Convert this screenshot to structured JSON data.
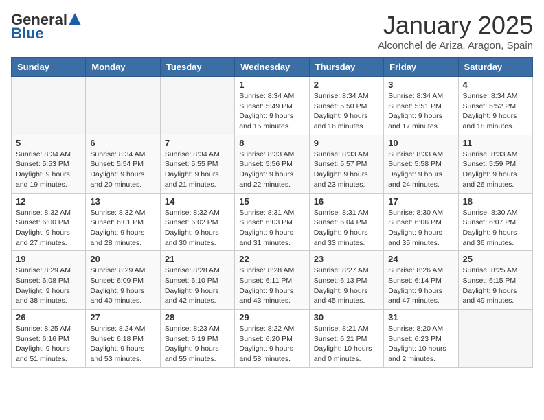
{
  "header": {
    "logo_general": "General",
    "logo_blue": "Blue",
    "month_title": "January 2025",
    "subtitle": "Alconchel de Ariza, Aragon, Spain"
  },
  "days_of_week": [
    "Sunday",
    "Monday",
    "Tuesday",
    "Wednesday",
    "Thursday",
    "Friday",
    "Saturday"
  ],
  "weeks": [
    [
      {
        "day": "",
        "info": ""
      },
      {
        "day": "",
        "info": ""
      },
      {
        "day": "",
        "info": ""
      },
      {
        "day": "1",
        "info": "Sunrise: 8:34 AM\nSunset: 5:49 PM\nDaylight: 9 hours\nand 15 minutes."
      },
      {
        "day": "2",
        "info": "Sunrise: 8:34 AM\nSunset: 5:50 PM\nDaylight: 9 hours\nand 16 minutes."
      },
      {
        "day": "3",
        "info": "Sunrise: 8:34 AM\nSunset: 5:51 PM\nDaylight: 9 hours\nand 17 minutes."
      },
      {
        "day": "4",
        "info": "Sunrise: 8:34 AM\nSunset: 5:52 PM\nDaylight: 9 hours\nand 18 minutes."
      }
    ],
    [
      {
        "day": "5",
        "info": "Sunrise: 8:34 AM\nSunset: 5:53 PM\nDaylight: 9 hours\nand 19 minutes."
      },
      {
        "day": "6",
        "info": "Sunrise: 8:34 AM\nSunset: 5:54 PM\nDaylight: 9 hours\nand 20 minutes."
      },
      {
        "day": "7",
        "info": "Sunrise: 8:34 AM\nSunset: 5:55 PM\nDaylight: 9 hours\nand 21 minutes."
      },
      {
        "day": "8",
        "info": "Sunrise: 8:33 AM\nSunset: 5:56 PM\nDaylight: 9 hours\nand 22 minutes."
      },
      {
        "day": "9",
        "info": "Sunrise: 8:33 AM\nSunset: 5:57 PM\nDaylight: 9 hours\nand 23 minutes."
      },
      {
        "day": "10",
        "info": "Sunrise: 8:33 AM\nSunset: 5:58 PM\nDaylight: 9 hours\nand 24 minutes."
      },
      {
        "day": "11",
        "info": "Sunrise: 8:33 AM\nSunset: 5:59 PM\nDaylight: 9 hours\nand 26 minutes."
      }
    ],
    [
      {
        "day": "12",
        "info": "Sunrise: 8:32 AM\nSunset: 6:00 PM\nDaylight: 9 hours\nand 27 minutes."
      },
      {
        "day": "13",
        "info": "Sunrise: 8:32 AM\nSunset: 6:01 PM\nDaylight: 9 hours\nand 28 minutes."
      },
      {
        "day": "14",
        "info": "Sunrise: 8:32 AM\nSunset: 6:02 PM\nDaylight: 9 hours\nand 30 minutes."
      },
      {
        "day": "15",
        "info": "Sunrise: 8:31 AM\nSunset: 6:03 PM\nDaylight: 9 hours\nand 31 minutes."
      },
      {
        "day": "16",
        "info": "Sunrise: 8:31 AM\nSunset: 6:04 PM\nDaylight: 9 hours\nand 33 minutes."
      },
      {
        "day": "17",
        "info": "Sunrise: 8:30 AM\nSunset: 6:06 PM\nDaylight: 9 hours\nand 35 minutes."
      },
      {
        "day": "18",
        "info": "Sunrise: 8:30 AM\nSunset: 6:07 PM\nDaylight: 9 hours\nand 36 minutes."
      }
    ],
    [
      {
        "day": "19",
        "info": "Sunrise: 8:29 AM\nSunset: 6:08 PM\nDaylight: 9 hours\nand 38 minutes."
      },
      {
        "day": "20",
        "info": "Sunrise: 8:29 AM\nSunset: 6:09 PM\nDaylight: 9 hours\nand 40 minutes."
      },
      {
        "day": "21",
        "info": "Sunrise: 8:28 AM\nSunset: 6:10 PM\nDaylight: 9 hours\nand 42 minutes."
      },
      {
        "day": "22",
        "info": "Sunrise: 8:28 AM\nSunset: 6:11 PM\nDaylight: 9 hours\nand 43 minutes."
      },
      {
        "day": "23",
        "info": "Sunrise: 8:27 AM\nSunset: 6:13 PM\nDaylight: 9 hours\nand 45 minutes."
      },
      {
        "day": "24",
        "info": "Sunrise: 8:26 AM\nSunset: 6:14 PM\nDaylight: 9 hours\nand 47 minutes."
      },
      {
        "day": "25",
        "info": "Sunrise: 8:25 AM\nSunset: 6:15 PM\nDaylight: 9 hours\nand 49 minutes."
      }
    ],
    [
      {
        "day": "26",
        "info": "Sunrise: 8:25 AM\nSunset: 6:16 PM\nDaylight: 9 hours\nand 51 minutes."
      },
      {
        "day": "27",
        "info": "Sunrise: 8:24 AM\nSunset: 6:18 PM\nDaylight: 9 hours\nand 53 minutes."
      },
      {
        "day": "28",
        "info": "Sunrise: 8:23 AM\nSunset: 6:19 PM\nDaylight: 9 hours\nand 55 minutes."
      },
      {
        "day": "29",
        "info": "Sunrise: 8:22 AM\nSunset: 6:20 PM\nDaylight: 9 hours\nand 58 minutes."
      },
      {
        "day": "30",
        "info": "Sunrise: 8:21 AM\nSunset: 6:21 PM\nDaylight: 10 hours\nand 0 minutes."
      },
      {
        "day": "31",
        "info": "Sunrise: 8:20 AM\nSunset: 6:23 PM\nDaylight: 10 hours\nand 2 minutes."
      },
      {
        "day": "",
        "info": ""
      }
    ]
  ]
}
